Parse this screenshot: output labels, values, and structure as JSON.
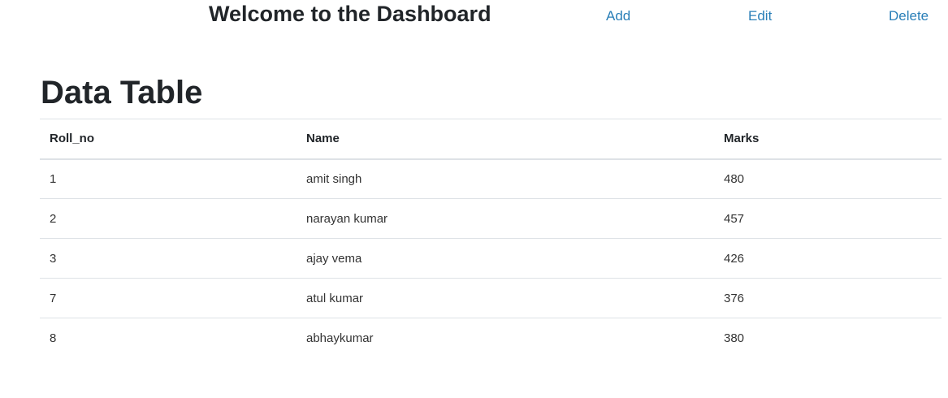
{
  "header": {
    "title": "Welcome to the Dashboard",
    "nav": {
      "add_label": "Add",
      "edit_label": "Edit",
      "delete_label": "Delete"
    }
  },
  "main": {
    "section_title": "Data Table",
    "table": {
      "columns": [
        "Roll_no",
        "Name",
        "Marks"
      ],
      "rows": [
        [
          "1",
          "amit singh",
          "480"
        ],
        [
          "2",
          "narayan kumar",
          "457"
        ],
        [
          "3",
          "ajay vema",
          "426"
        ],
        [
          "7",
          "atul kumar",
          "376"
        ],
        [
          "8",
          "abhaykumar",
          "380"
        ]
      ]
    }
  },
  "colors": {
    "link": "#2a7fb8",
    "text": "#212529",
    "border": "#dee2e6"
  }
}
